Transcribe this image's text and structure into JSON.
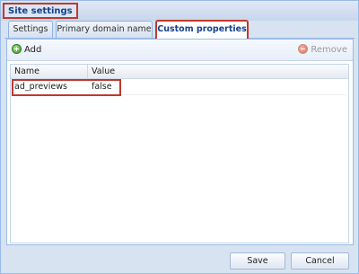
{
  "window": {
    "title": "Site settings"
  },
  "tabs": [
    {
      "label": "Settings"
    },
    {
      "label": "Primary domain name"
    },
    {
      "label": "Custom properties",
      "active": true
    }
  ],
  "toolbar": {
    "add_label": "Add",
    "remove_label": "Remove",
    "add_icon": "add-icon",
    "remove_icon": "remove-icon"
  },
  "grid": {
    "columns": [
      "Name",
      "Value"
    ],
    "rows": [
      {
        "name": "ad_previews",
        "value": "false"
      }
    ]
  },
  "footer": {
    "save_label": "Save",
    "cancel_label": "Cancel"
  },
  "colors": {
    "highlight": "#c0392b",
    "border": "#99bbe8",
    "title_text": "#15428b"
  }
}
